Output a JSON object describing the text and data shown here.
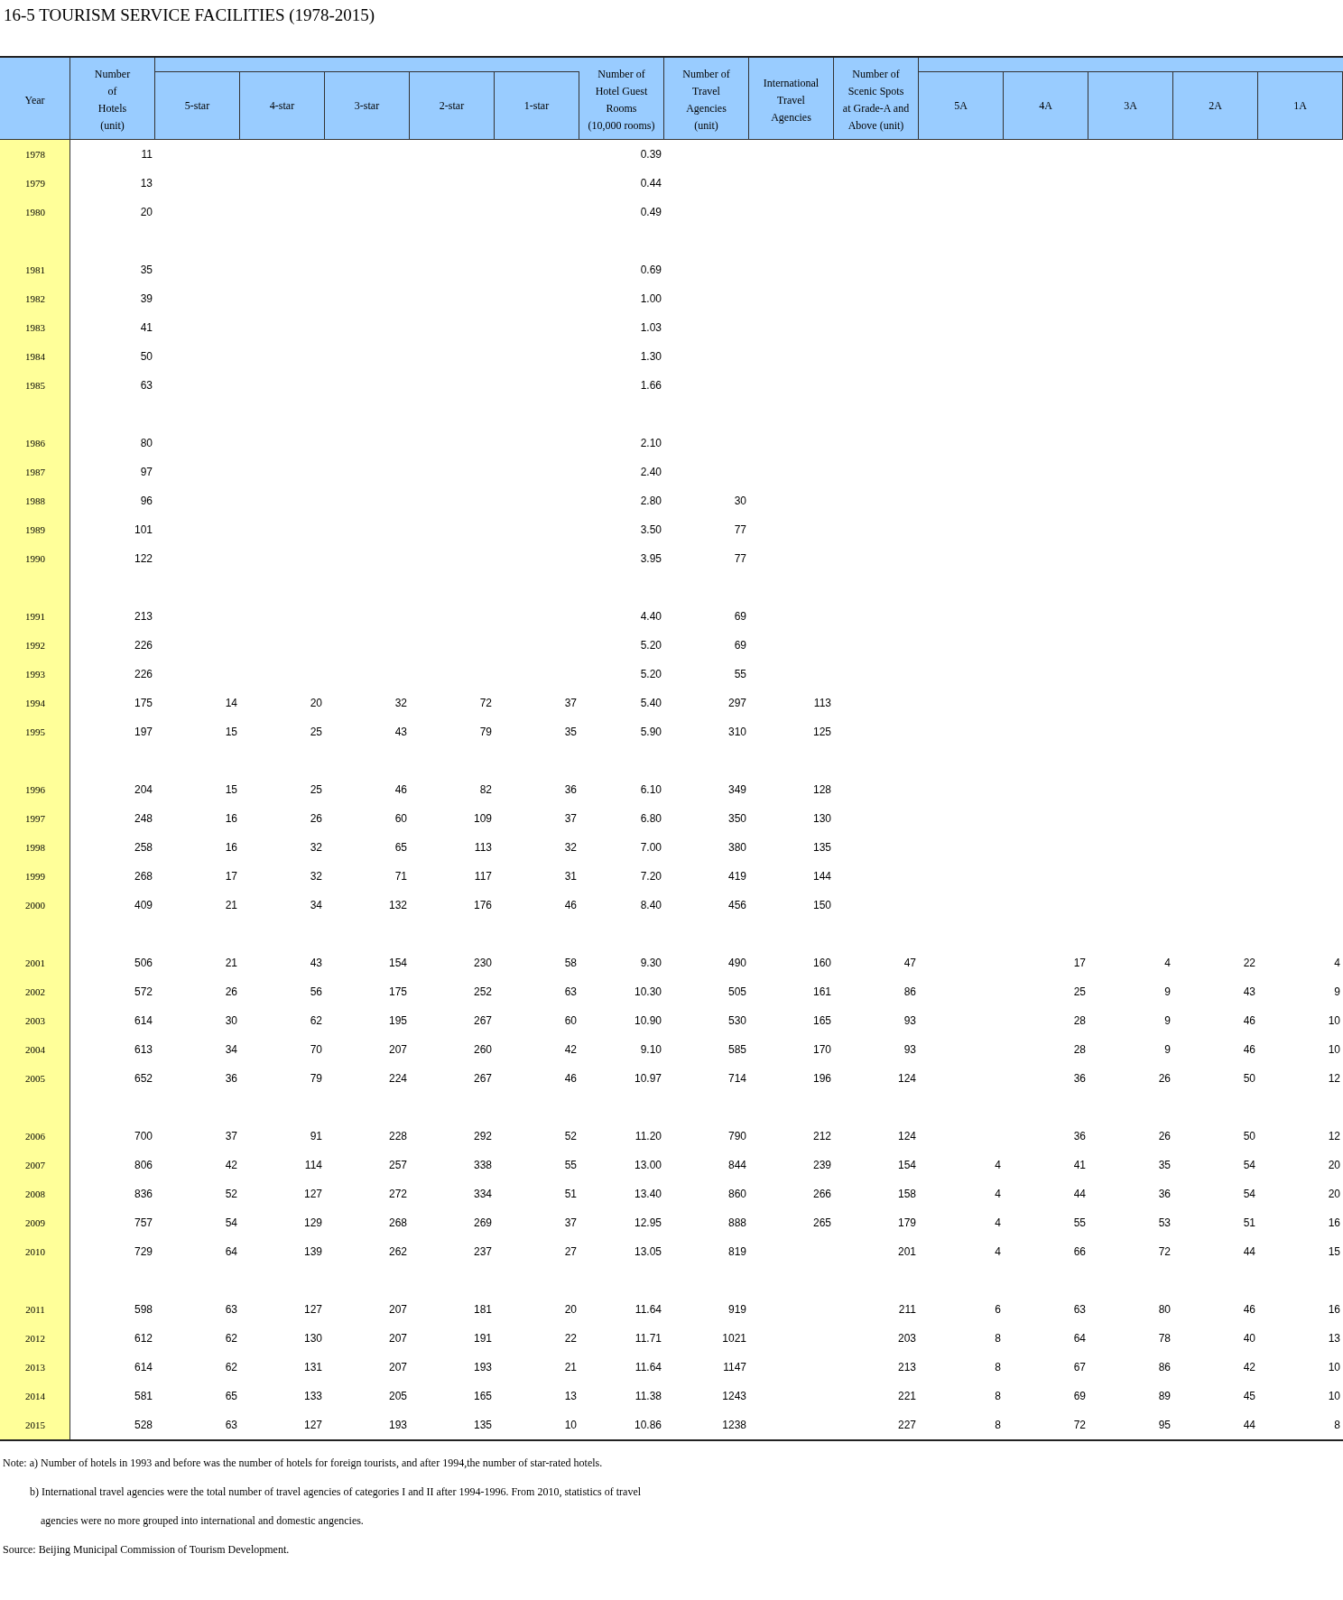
{
  "title": "16-5   TOURISM SERVICE FACILITIES (1978-2015)",
  "columns": [
    {
      "label": "Year",
      "grouped": false
    },
    {
      "label": "Number\nof\nHotels\n(unit)",
      "grouped": false
    },
    {
      "label": "5-star",
      "grouped": true
    },
    {
      "label": "4-star",
      "grouped": true
    },
    {
      "label": "3-star",
      "grouped": true
    },
    {
      "label": "2-star",
      "grouped": true
    },
    {
      "label": "1-star",
      "grouped": true
    },
    {
      "label": "Number of\nHotel Guest\nRooms\n(10,000 rooms)",
      "grouped": false
    },
    {
      "label": "Number of\nTravel\nAgencies\n(unit)",
      "grouped": false
    },
    {
      "label": "International\nTravel\nAgencies",
      "grouped": false
    },
    {
      "label": "Number of\nScenic Spots\nat Grade-A and\nAbove (unit)",
      "grouped": false
    },
    {
      "label": "5A",
      "grouped": true
    },
    {
      "label": "4A",
      "grouped": true
    },
    {
      "label": "3A",
      "grouped": true
    },
    {
      "label": "2A",
      "grouped": true
    },
    {
      "label": "1A",
      "grouped": true
    }
  ],
  "groups": [
    [
      {
        "year": "1978",
        "hotels": "11",
        "rooms": "0.39"
      },
      {
        "year": "1979",
        "hotels": "13",
        "rooms": "0.44"
      },
      {
        "year": "1980",
        "hotels": "20",
        "rooms": "0.49"
      }
    ],
    [
      {
        "year": "1981",
        "hotels": "35",
        "rooms": "0.69"
      },
      {
        "year": "1982",
        "hotels": "39",
        "rooms": "1.00"
      },
      {
        "year": "1983",
        "hotels": "41",
        "rooms": "1.03"
      },
      {
        "year": "1984",
        "hotels": "50",
        "rooms": "1.30"
      },
      {
        "year": "1985",
        "hotels": "63",
        "rooms": "1.66"
      }
    ],
    [
      {
        "year": "1986",
        "hotels": "80",
        "rooms": "2.10"
      },
      {
        "year": "1987",
        "hotels": "97",
        "rooms": "2.40"
      },
      {
        "year": "1988",
        "hotels": "96",
        "rooms": "2.80",
        "agencies": "30"
      },
      {
        "year": "1989",
        "hotels": "101",
        "rooms": "3.50",
        "agencies": "77"
      },
      {
        "year": "1990",
        "hotels": "122",
        "rooms": "3.95",
        "agencies": "77"
      }
    ],
    [
      {
        "year": "1991",
        "hotels": "213",
        "rooms": "4.40",
        "agencies": "69"
      },
      {
        "year": "1992",
        "hotels": "226",
        "rooms": "5.20",
        "agencies": "69"
      },
      {
        "year": "1993",
        "hotels": "226",
        "rooms": "5.20",
        "agencies": "55"
      },
      {
        "year": "1994",
        "hotels": "175",
        "s5": "14",
        "s4": "20",
        "s3": "32",
        "s2": "72",
        "s1": "37",
        "rooms": "5.40",
        "agencies": "297",
        "intl": "113"
      },
      {
        "year": "1995",
        "hotels": "197",
        "s5": "15",
        "s4": "25",
        "s3": "43",
        "s2": "79",
        "s1": "35",
        "rooms": "5.90",
        "agencies": "310",
        "intl": "125"
      }
    ],
    [
      {
        "year": "1996",
        "hotels": "204",
        "s5": "15",
        "s4": "25",
        "s3": "46",
        "s2": "82",
        "s1": "36",
        "rooms": "6.10",
        "agencies": "349",
        "intl": "128"
      },
      {
        "year": "1997",
        "hotels": "248",
        "s5": "16",
        "s4": "26",
        "s3": "60",
        "s2": "109",
        "s1": "37",
        "rooms": "6.80",
        "agencies": "350",
        "intl": "130"
      },
      {
        "year": "1998",
        "hotels": "258",
        "s5": "16",
        "s4": "32",
        "s3": "65",
        "s2": "113",
        "s1": "32",
        "rooms": "7.00",
        "agencies": "380",
        "intl": "135"
      },
      {
        "year": "1999",
        "hotels": "268",
        "s5": "17",
        "s4": "32",
        "s3": "71",
        "s2": "117",
        "s1": "31",
        "rooms": "7.20",
        "agencies": "419",
        "intl": "144"
      },
      {
        "year": "2000",
        "hotels": "409",
        "s5": "21",
        "s4": "34",
        "s3": "132",
        "s2": "176",
        "s1": "46",
        "rooms": "8.40",
        "agencies": "456",
        "intl": "150"
      }
    ],
    [
      {
        "year": "2001",
        "hotels": "506",
        "s5": "21",
        "s4": "43",
        "s3": "154",
        "s2": "230",
        "s1": "58",
        "rooms": "9.30",
        "agencies": "490",
        "intl": "160",
        "scenic": "47",
        "a4": "17",
        "a3": "4",
        "a2": "22",
        "a1": "4"
      },
      {
        "year": "2002",
        "hotels": "572",
        "s5": "26",
        "s4": "56",
        "s3": "175",
        "s2": "252",
        "s1": "63",
        "rooms": "10.30",
        "agencies": "505",
        "intl": "161",
        "scenic": "86",
        "a4": "25",
        "a3": "9",
        "a2": "43",
        "a1": "9"
      },
      {
        "year": "2003",
        "hotels": "614",
        "s5": "30",
        "s4": "62",
        "s3": "195",
        "s2": "267",
        "s1": "60",
        "rooms": "10.90",
        "agencies": "530",
        "intl": "165",
        "scenic": "93",
        "a4": "28",
        "a3": "9",
        "a2": "46",
        "a1": "10"
      },
      {
        "year": "2004",
        "hotels": "613",
        "s5": "34",
        "s4": "70",
        "s3": "207",
        "s2": "260",
        "s1": "42",
        "rooms": "9.10",
        "agencies": "585",
        "intl": "170",
        "scenic": "93",
        "a4": "28",
        "a3": "9",
        "a2": "46",
        "a1": "10"
      },
      {
        "year": "2005",
        "hotels": "652",
        "s5": "36",
        "s4": "79",
        "s3": "224",
        "s2": "267",
        "s1": "46",
        "rooms": "10.97",
        "agencies": "714",
        "intl": "196",
        "scenic": "124",
        "a4": "36",
        "a3": "26",
        "a2": "50",
        "a1": "12"
      }
    ],
    [
      {
        "year": "2006",
        "hotels": "700",
        "s5": "37",
        "s4": "91",
        "s3": "228",
        "s2": "292",
        "s1": "52",
        "rooms": "11.20",
        "agencies": "790",
        "intl": "212",
        "scenic": "124",
        "a4": "36",
        "a3": "26",
        "a2": "50",
        "a1": "12"
      },
      {
        "year": "2007",
        "hotels": "806",
        "s5": "42",
        "s4": "114",
        "s3": "257",
        "s2": "338",
        "s1": "55",
        "rooms": "13.00",
        "agencies": "844",
        "intl": "239",
        "scenic": "154",
        "a5": "4",
        "a4": "41",
        "a3": "35",
        "a2": "54",
        "a1": "20"
      },
      {
        "year": "2008",
        "hotels": "836",
        "s5": "52",
        "s4": "127",
        "s3": "272",
        "s2": "334",
        "s1": "51",
        "rooms": "13.40",
        "agencies": "860",
        "intl": "266",
        "scenic": "158",
        "a5": "4",
        "a4": "44",
        "a3": "36",
        "a2": "54",
        "a1": "20"
      },
      {
        "year": "2009",
        "hotels": "757",
        "s5": "54",
        "s4": "129",
        "s3": "268",
        "s2": "269",
        "s1": "37",
        "rooms": "12.95",
        "agencies": "888",
        "intl": "265",
        "scenic": "179",
        "a5": "4",
        "a4": "55",
        "a3": "53",
        "a2": "51",
        "a1": "16"
      },
      {
        "year": "2010",
        "hotels": "729",
        "s5": "64",
        "s4": "139",
        "s3": "262",
        "s2": "237",
        "s1": "27",
        "rooms": "13.05",
        "agencies": "819",
        "scenic": "201",
        "a5": "4",
        "a4": "66",
        "a3": "72",
        "a2": "44",
        "a1": "15"
      }
    ],
    [
      {
        "year": "2011",
        "hotels": "598",
        "s5": "63",
        "s4": "127",
        "s3": "207",
        "s2": "181",
        "s1": "20",
        "rooms": "11.64",
        "agencies": "919",
        "scenic": "211",
        "a5": "6",
        "a4": "63",
        "a3": "80",
        "a2": "46",
        "a1": "16"
      },
      {
        "year": "2012",
        "hotels": "612",
        "s5": "62",
        "s4": "130",
        "s3": "207",
        "s2": "191",
        "s1": "22",
        "rooms": "11.71",
        "agencies": "1021",
        "scenic": "203",
        "a5": "8",
        "a4": "64",
        "a3": "78",
        "a2": "40",
        "a1": "13"
      },
      {
        "year": "2013",
        "hotels": "614",
        "s5": "62",
        "s4": "131",
        "s3": "207",
        "s2": "193",
        "s1": "21",
        "rooms": "11.64",
        "agencies": "1147",
        "scenic": "213",
        "a5": "8",
        "a4": "67",
        "a3": "86",
        "a2": "42",
        "a1": "10"
      },
      {
        "year": "2014",
        "hotels": "581",
        "s5": "65",
        "s4": "133",
        "s3": "205",
        "s2": "165",
        "s1": "13",
        "rooms": "11.38",
        "agencies": "1243",
        "scenic": "221",
        "a5": "8",
        "a4": "69",
        "a3": "89",
        "a2": "45",
        "a1": "10"
      },
      {
        "year": "2015",
        "hotels": "528",
        "s5": "63",
        "s4": "127",
        "s3": "193",
        "s2": "135",
        "s1": "10",
        "rooms": "10.86",
        "agencies": "1238",
        "scenic": "227",
        "a5": "8",
        "a4": "72",
        "a3": "95",
        "a2": "44",
        "a1": "8"
      }
    ]
  ],
  "notes": [
    {
      "kind": "first",
      "text": "Note: a) Number of hotels in 1993 and before was the number of hotels for foreign tourists, and after 1994,the number of star-rated hotels."
    },
    {
      "kind": "indent",
      "text": "b) International travel agencies were the total number of travel agencies of categories I and II after 1994-1996. From 2010, statistics of travel"
    },
    {
      "kind": "indent2",
      "text": "agencies were no more grouped into international and domestic angencies."
    },
    {
      "kind": "first",
      "text": "Source: Beijing Municipal Commission of Tourism Development."
    }
  ]
}
